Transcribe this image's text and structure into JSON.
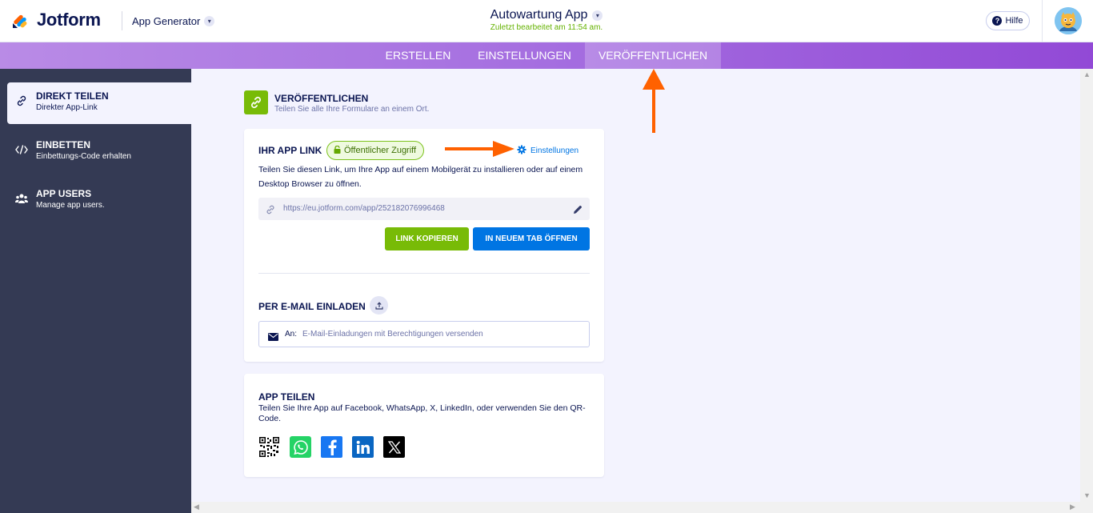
{
  "header": {
    "brand": "Jotform",
    "product_switcher": "App Generator",
    "app_title": "Autowartung App",
    "last_edited": "Zuletzt bearbeitet am 11:54 am.",
    "help_label": "Hilfe"
  },
  "tabs": [
    {
      "label": "ERSTELLEN",
      "active": false
    },
    {
      "label": "EINSTELLUNGEN",
      "active": false
    },
    {
      "label": "VERÖFFENTLICHEN",
      "active": true
    }
  ],
  "sidebar": {
    "items": [
      {
        "title": "DIREKT TEILEN",
        "subtitle": "Direkter App-Link",
        "icon": "link-icon",
        "active": true
      },
      {
        "title": "EINBETTEN",
        "subtitle": "Einbettungs-Code erhalten",
        "icon": "code-icon",
        "active": false
      },
      {
        "title": "APP USERS",
        "subtitle": "Manage app users.",
        "icon": "users-icon",
        "active": false
      }
    ]
  },
  "publish": {
    "title": "VERÖFFENTLICHEN",
    "subtitle": "Teilen Sie alle Ihre Formulare an einem Ort."
  },
  "app_link": {
    "title": "IHR APP LINK",
    "badge": "Öffentlicher Zugriff",
    "settings_label": "Einstellungen",
    "description": "Teilen Sie diesen Link, um Ihre App auf einem Mobilgerät zu installieren oder auf einem Desktop Browser zu öffnen.",
    "url": "https://eu.jotform.com/app/252182076996468",
    "copy_button": "LINK KOPIEREN",
    "open_button": "IN NEUEM TAB ÖFFNEN"
  },
  "email_invite": {
    "title": "PER E-MAIL EINLADEN",
    "to_label": "An:",
    "placeholder": "E-Mail-Einladungen mit Berechtigungen versenden"
  },
  "share": {
    "title": "APP TEILEN",
    "description": "Teilen Sie Ihre App auf Facebook, WhatsApp, X, LinkedIn, oder verwenden Sie den QR-Code.",
    "icons": [
      "qr-code-icon",
      "whatsapp-icon",
      "facebook-icon",
      "linkedin-icon",
      "x-icon"
    ]
  },
  "colors": {
    "accent_green": "#78bb07",
    "accent_blue": "#0075e3",
    "sidebar_bg": "#343a54",
    "tab_purple": "#a56ee0",
    "annotation_orange": "#ff6100"
  }
}
